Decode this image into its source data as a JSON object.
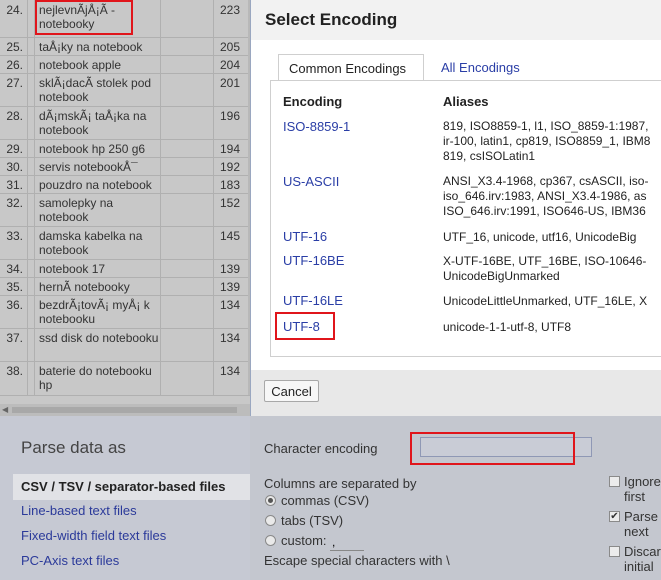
{
  "table_rows": [
    {
      "num": "24.",
      "term": "nejlevnÃ­jÅ¡Ã­ - notebooky",
      "count": "223"
    },
    {
      "num": "25.",
      "term": "taÅ¡ky na notebook",
      "count": "205"
    },
    {
      "num": "26.",
      "term": "notebook apple",
      "count": "204"
    },
    {
      "num": "27.",
      "term": "sklÃ¡dacÃ­ stolek pod notebook",
      "count": "201"
    },
    {
      "num": "28.",
      "term": "dÃ¡mskÃ¡ taÅ¡ka na notebook",
      "count": "196"
    },
    {
      "num": "29.",
      "term": "notebook hp 250 g6",
      "count": "194"
    },
    {
      "num": "30.",
      "term": "servis notebookÅ¯",
      "count": "192"
    },
    {
      "num": "31.",
      "term": "pouzdro na notebook",
      "count": "183"
    },
    {
      "num": "32.",
      "term": "samolepky na notebook",
      "count": "152"
    },
    {
      "num": "33.",
      "term": "damska kabelka na notebook",
      "count": "145"
    },
    {
      "num": "34.",
      "term": "notebook 17",
      "count": "139"
    },
    {
      "num": "35.",
      "term": "hernÃ­ notebooky",
      "count": "139"
    },
    {
      "num": "36.",
      "term": "bezdrÃ¡tovÃ¡ myÅ¡ k notebooku",
      "count": "134"
    },
    {
      "num": "37.",
      "term": "ssd disk do notebooku",
      "count": "134"
    },
    {
      "num": "38.",
      "term": "baterie do notebooku hp",
      "count": "134"
    }
  ],
  "dialog": {
    "title": "Select Encoding",
    "tabs": [
      "Common Encodings",
      "All Encodings"
    ],
    "columns": [
      "Encoding",
      "Aliases"
    ],
    "encodings": [
      {
        "name": "ISO-8859-1",
        "aliases": "819, ISO8859-1, l1, ISO_8859-1:1987,\nir-100, latin1, cp819, ISO8859_1, IBM8\n819, csISOLatin1"
      },
      {
        "name": "US-ASCII",
        "aliases": "ANSI_X3.4-1968, cp367, csASCII, iso-\niso_646.irv:1983, ANSI_X3.4-1986, as\nISO_646.irv:1991, ISO646-US, IBM36"
      },
      {
        "name": "UTF-16",
        "aliases": "UTF_16, unicode, utf16, UnicodeBig"
      },
      {
        "name": "UTF-16BE",
        "aliases": "X-UTF-16BE, UTF_16BE, ISO-10646-\nUnicodeBigUnmarked"
      },
      {
        "name": "UTF-16LE",
        "aliases": "UnicodeLittleUnmarked, UTF_16LE, X"
      },
      {
        "name": "UTF-8",
        "aliases": "unicode-1-1-utf-8, UTF8"
      }
    ],
    "cancel_label": "Cancel"
  },
  "parse": {
    "title": "Parse data as",
    "formats": [
      "CSV / TSV / separator-based files",
      "Line-based text files",
      "Fixed-width field text files",
      "PC-Axis text files"
    ],
    "encoding_label": "Character encoding",
    "encoding_value": "",
    "columns_label": "Columns are separated by",
    "sep_options": [
      "commas (CSV)",
      "tabs (TSV)",
      "custom:"
    ],
    "custom_value": ",",
    "escape_label": "Escape special characters with \\",
    "right_options": [
      {
        "line1": "Ignore",
        "line2": "first",
        "checked": false
      },
      {
        "line1": "Parse",
        "line2": "next",
        "checked": true
      },
      {
        "line1": "Discar",
        "line2": "initial",
        "checked": false
      }
    ]
  },
  "colors": {
    "accent_link": "#2a3ea6",
    "highlight_red": "#e0151b"
  }
}
